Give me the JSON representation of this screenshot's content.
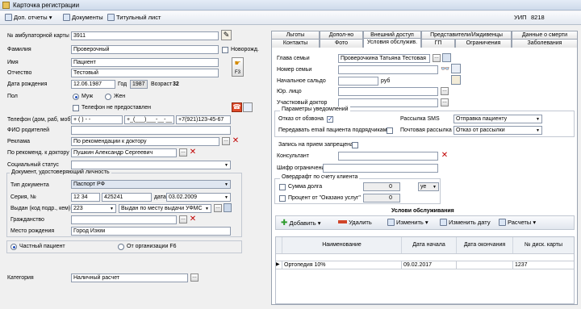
{
  "window": {
    "title": "Карточка регистрации"
  },
  "toolbar": {
    "reports": "Доп. отчеты",
    "documents": "Документы",
    "title_sheet": "Титульный лист",
    "uip_label": "УИП",
    "uip_value": "8218"
  },
  "left": {
    "card_no_label": "№ амбулаторной карты",
    "card_no": "3911",
    "surname_label": "Фамилия",
    "surname": "Проверочный",
    "newborn_label": "Новорожд.",
    "name_label": "Имя",
    "name": "Пациент",
    "patronymic_label": "Отчество",
    "patronymic": "Тестовый",
    "dob_label": "Дата рождения",
    "dob": "12.06.1987",
    "year_label": "Год",
    "year": "1987",
    "age_label": "Возраст",
    "age": "32",
    "f3": "F3",
    "sex_label": "Пол",
    "male": "Муж",
    "female": "Жен",
    "phone_na_label": "Телефон не предоставлен",
    "phone_label": "Телефон (дом, раб, моб)",
    "phone_home": "+ (  )    -  -",
    "phone_work": "+_(___)___-__-__",
    "phone_mob": "+7(921)123-45-67",
    "parents_label": "ФИО родителей",
    "ad_label": "Реклама",
    "ad": "По рекомендации к доктору",
    "rec_doctor_label": "По рекоменд. к доктору",
    "rec_doctor": "Пушкин Александр Сергеевич",
    "social_label": "Социальный статус",
    "doc_group": "Документ, удостоверяющий личность",
    "doc_type_label": "Тип документа",
    "doc_type": "Паспорт РФ",
    "series_label": "Серия, №",
    "series": "12 34",
    "number": "425241",
    "date_label": "дата",
    "date": "03.02.2009",
    "issued_label": "Выдан (код подр., кем)",
    "issued_code": "223",
    "issued_by": "Выдан по месту выдачи УФМС",
    "citizenship_label": "Гражданство",
    "birthplace_label": "Место рождения",
    "birthplace": "Город Изюм",
    "private_label": "Частный пациент",
    "org_label": "От организации F6",
    "category_label": "Категория",
    "category": "Наличный расчет"
  },
  "tabs_row1": [
    "Льготы",
    "Допол-но",
    "Внешний доступ",
    "Представители/Иждивенцы",
    "Данные о смерти"
  ],
  "tabs_row2": [
    "Контакты",
    "Фото",
    "Условия обслужив.",
    "ГП",
    "Ограничения",
    "Заболевания"
  ],
  "right": {
    "head_label": "Глава семьи",
    "head": "Проверочкина Татьяна Тестовая",
    "family_no_label": "Номер семьи",
    "balance_label": "Начальное сальдо",
    "balance_unit": "руб",
    "legal_label": "Юр. лицо",
    "attending_label": "Участковый доктор",
    "notif_group": "Параметры уведомлений",
    "call_refuse_label": "Отказ от обзвона",
    "sms_label": "Рассылка SMS",
    "sms_value": "Отправка пациенту",
    "email_label": "Передавать email пациента подрядчикам",
    "mail_label": "Почтовая рассылка",
    "mail_value": "Отказ от рассылки",
    "appt_banned_label": "Запись на прием запрещена",
    "consultant_label": "Консультант",
    "restrict_label": "Шифр ограничений",
    "overdraft_group": "Овердрафт по счету клиента",
    "debt_label": "Сумма долга",
    "debt_value": "0",
    "debt_unit": "уе",
    "percent_label": "Процент от \"Оказано услуг\"",
    "percent_value": "0",
    "services_title": "Услови обслуживания",
    "add": "Добавить",
    "delete": "Удалить",
    "edit": "Изменить",
    "change_date": "Изменить дату",
    "calc": "Расчеты",
    "grid_headers": [
      "Наименование",
      "Дата начала",
      "Дата окончания",
      "№ диск. карты"
    ],
    "grid_rows": [
      {
        "name": "Ортопедия 10%",
        "start": "09.02.2017",
        "end": "",
        "card": "1237"
      }
    ]
  }
}
